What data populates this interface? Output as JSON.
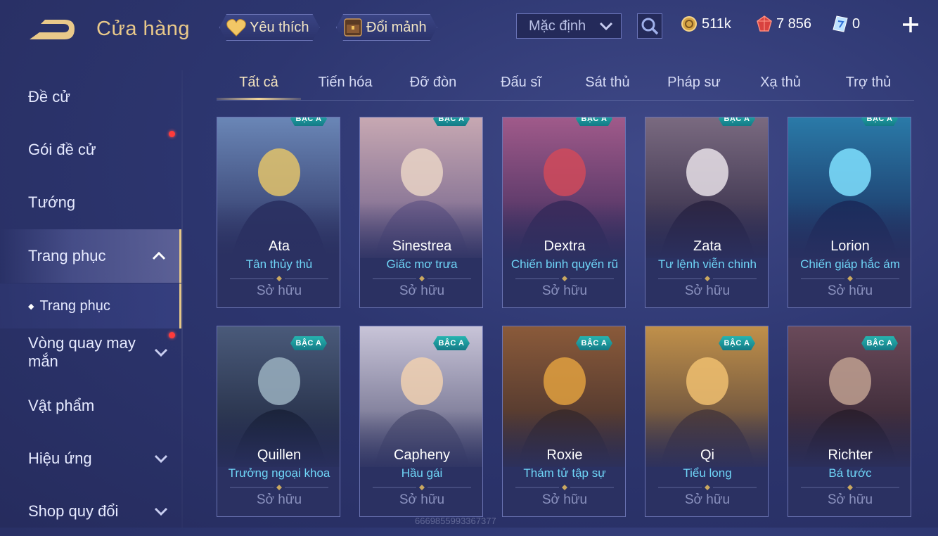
{
  "header": {
    "title": "Cửa hàng",
    "favorite_label": "Yêu thích",
    "exchange_label": "Đổi mảnh",
    "sort_value": "Mặc định",
    "currencies": [
      {
        "icon": "gold-coin-icon",
        "value": "511k"
      },
      {
        "icon": "red-gem-icon",
        "value": "7 856"
      },
      {
        "icon": "voucher-icon",
        "value": "0"
      }
    ]
  },
  "sidebar": {
    "items": [
      {
        "label": "Đề cử"
      },
      {
        "label": "Gói đề cử"
      },
      {
        "label": "Tướng"
      },
      {
        "label": "Trang phục"
      },
      {
        "label": "Trang phục"
      },
      {
        "label": "Vòng quay may mắn"
      },
      {
        "label": "Vật phẩm"
      },
      {
        "label": "Hiệu ứng"
      },
      {
        "label": "Shop quy đổi"
      }
    ]
  },
  "tabs": [
    "Tất cả",
    "Tiến hóa",
    "Đỡ đòn",
    "Đấu sĩ",
    "Sát thủ",
    "Pháp sư",
    "Xạ thủ",
    "Trợ thủ"
  ],
  "active_tab": "Tất cả",
  "cards": [
    {
      "hero": "Ata",
      "skin": "Tân thủy thủ",
      "badge": "BẬC A",
      "status": "Sở hữu"
    },
    {
      "hero": "Sinestrea",
      "skin": "Giấc mơ trưa",
      "badge": "BẬC A",
      "status": "Sở hữu"
    },
    {
      "hero": "Dextra",
      "skin": "Chiến binh quyến rũ",
      "badge": "BẬC A",
      "status": "Sở hữu"
    },
    {
      "hero": "Zata",
      "skin": "Tư lệnh viễn chinh",
      "badge": "BẬC A",
      "status": "Sở hữu"
    },
    {
      "hero": "Lorion",
      "skin": "Chiến giáp hắc ám",
      "badge": "BẬC A",
      "status": "Sở hữu"
    },
    {
      "hero": "Quillen",
      "skin": "Trưởng ngoại khoa",
      "badge": "BẬC A",
      "status": "Sở hữu"
    },
    {
      "hero": "Capheny",
      "skin": "Hầu gái",
      "badge": "BẬC A",
      "status": "Sở hữu"
    },
    {
      "hero": "Roxie",
      "skin": "Thám tử tập sự",
      "badge": "BẬC A",
      "status": "Sở hữu"
    },
    {
      "hero": "Qi",
      "skin": "Tiểu long",
      "badge": "BẬC A",
      "status": "Sở hữu"
    },
    {
      "hero": "Richter",
      "skin": "Bá tước",
      "badge": "BẬC A",
      "status": "Sở hữu"
    }
  ],
  "watermark": "6669855993367377",
  "colors": {
    "accent_gold": "#e9c98a",
    "skin_name": "#6fd5f7",
    "badge_teal": "#1e9aa0",
    "notification_red": "#ff3b3b"
  }
}
